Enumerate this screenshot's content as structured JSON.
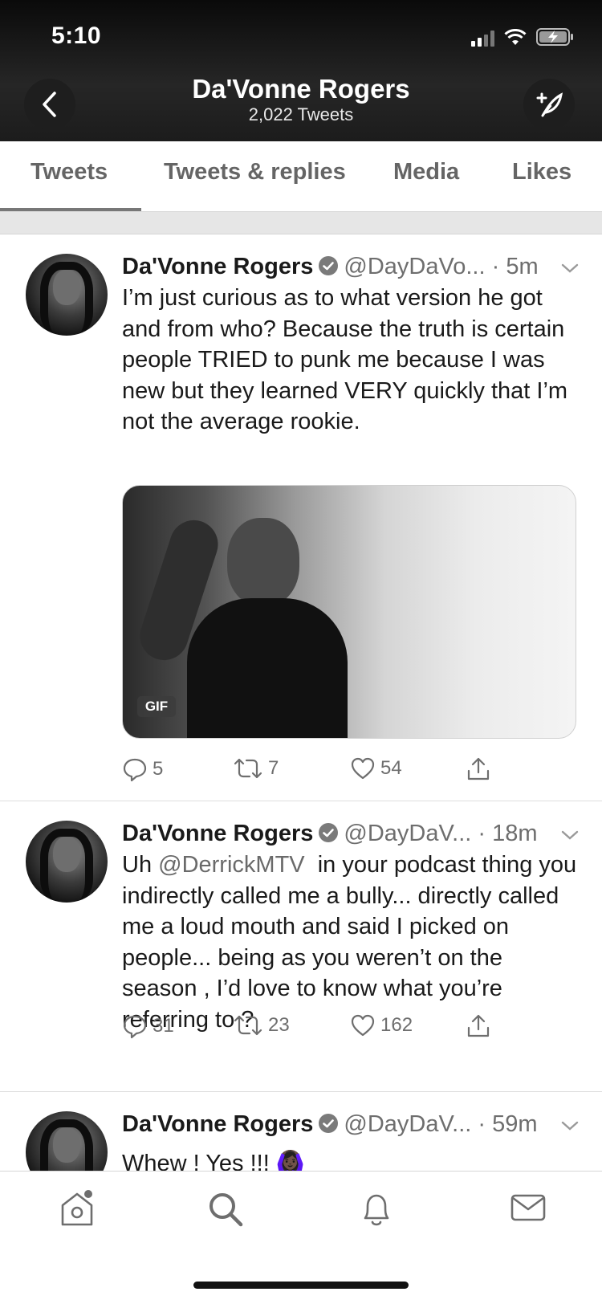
{
  "status_bar": {
    "time": "5:10"
  },
  "header": {
    "title": "Da'Vonne Rogers",
    "subtitle": "2,022 Tweets"
  },
  "tabs": [
    {
      "label": "Tweets",
      "selected": true
    },
    {
      "label": "Tweets & replies",
      "selected": false
    },
    {
      "label": "Media",
      "selected": false
    },
    {
      "label": "Likes",
      "selected": false
    }
  ],
  "tweets": [
    {
      "name": "Da'Vonne Rogers",
      "handle": "@DayDaVo...",
      "time": "5m",
      "text": "I’m just curious as to what version he got and from who? Because the truth is certain people TRIED to punk me because I was new but they learned VERY quickly that I’m not the average rookie.",
      "media_badge": "GIF",
      "replies": "5",
      "retweets": "7",
      "likes": "54"
    },
    {
      "name": "Da'Vonne Rogers",
      "handle": "@DayDaV...",
      "time": "18m",
      "text_prefix": "Uh ",
      "mention": "@DerrickMTV",
      "text_suffix": "  in your podcast thing you indirectly called me a bully... directly called me a loud mouth and said I picked on people... being as you weren’t on the season , I’d love to know what you’re referring to ?",
      "replies": "31",
      "retweets": "23",
      "likes": "162"
    },
    {
      "name": "Da'Vonne Rogers",
      "handle": "@DayDaV...",
      "time": "59m",
      "text": "Whew ! Yes !!! 🙆🏿‍♀️"
    }
  ],
  "bottom_nav": {
    "items": [
      "home-icon",
      "search-icon",
      "notifications-icon",
      "messages-icon"
    ],
    "home_has_dot": true
  },
  "colors": {
    "header_bg": "#1c1c1c",
    "text": "#1a1a1a",
    "muted": "#6e6e6e"
  }
}
